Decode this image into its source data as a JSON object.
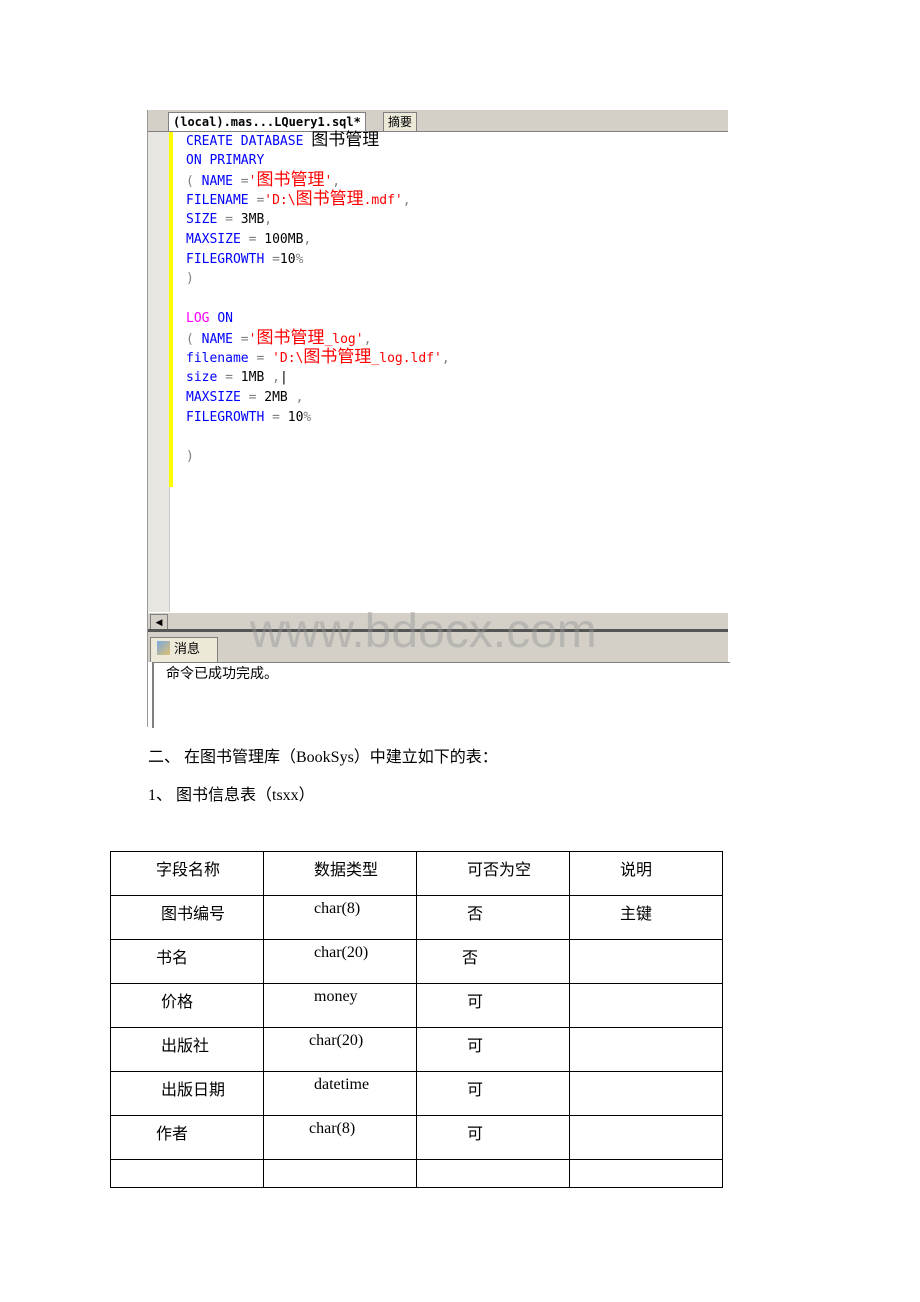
{
  "editor": {
    "tabs": [
      "(local).mas...LQuery1.sql*",
      "摘要"
    ],
    "code": [
      [
        [
          "CREATE DATABASE ",
          "kw"
        ],
        [
          "图书管理",
          "tx cjk"
        ]
      ],
      [
        [
          "ON PRIMARY",
          "kw"
        ]
      ],
      [
        [
          "( ",
          "op"
        ],
        [
          "NAME ",
          "kw"
        ],
        [
          "=",
          "op"
        ],
        [
          "'",
          "str"
        ],
        [
          "图书管理",
          "str cjk"
        ],
        [
          "'",
          "str"
        ],
        [
          ",",
          "op"
        ]
      ],
      [
        [
          "FILENAME ",
          "kw"
        ],
        [
          "=",
          "op"
        ],
        [
          "'D:\\",
          "str"
        ],
        [
          "图书管理",
          "str cjk"
        ],
        [
          ".mdf'",
          "str"
        ],
        [
          ",",
          "op"
        ]
      ],
      [
        [
          "SIZE ",
          "kw"
        ],
        [
          "= ",
          "op"
        ],
        [
          "3MB",
          ""
        ],
        [
          ",",
          "op"
        ]
      ],
      [
        [
          "MAXSIZE ",
          "kw"
        ],
        [
          "= ",
          "op"
        ],
        [
          "100MB",
          ""
        ],
        [
          ",",
          "op"
        ]
      ],
      [
        [
          "FILEGROWTH ",
          "kw"
        ],
        [
          "=",
          "op"
        ],
        [
          "10",
          ""
        ],
        [
          "%",
          "op"
        ]
      ],
      [
        [
          ")",
          "op"
        ]
      ],
      [],
      [
        [
          "LOG ",
          "fn"
        ],
        [
          "ON",
          "kw"
        ]
      ],
      [
        [
          "( ",
          "op"
        ],
        [
          "NAME ",
          "kw"
        ],
        [
          "=",
          "op"
        ],
        [
          "'",
          "str"
        ],
        [
          "图书管理",
          "str cjk"
        ],
        [
          "_log'",
          "str"
        ],
        [
          ",",
          "op"
        ]
      ],
      [
        [
          "filename ",
          "kw"
        ],
        [
          "= ",
          "op"
        ],
        [
          "'D:\\",
          "str"
        ],
        [
          "图书管理",
          "str cjk"
        ],
        [
          "_log.ldf'",
          "str"
        ],
        [
          ",",
          "op"
        ]
      ],
      [
        [
          "size ",
          "kw"
        ],
        [
          "= ",
          "op"
        ],
        [
          "1MB ",
          ""
        ],
        [
          ",",
          "op"
        ],
        [
          "|",
          ""
        ]
      ],
      [
        [
          "MAXSIZE ",
          "kw"
        ],
        [
          "= ",
          "op"
        ],
        [
          "2MB ",
          ""
        ],
        [
          ",",
          "op"
        ]
      ],
      [
        [
          "FILEGROWTH ",
          "kw"
        ],
        [
          "= ",
          "op"
        ],
        [
          "10",
          ""
        ],
        [
          "%",
          "op"
        ]
      ],
      [],
      [
        [
          ")",
          "op"
        ]
      ]
    ],
    "messages_tab": "消息",
    "message": "命令已成功完成。",
    "watermark": "www.bdocx.com"
  },
  "section_heading": "二、 在图书管理库（BookSys）中建立如下的表：",
  "subheading": "1、 图书信息表（tsxx）",
  "table": {
    "headers": [
      "字段名称",
      "数据类型",
      "可否为空",
      "说明"
    ],
    "rows": [
      [
        "图书编号",
        "char(8)",
        "否",
        "主键"
      ],
      [
        "书名",
        "char(20)",
        "否",
        ""
      ],
      [
        "价格",
        "money",
        "可",
        ""
      ],
      [
        "出版社",
        "char(20)",
        "可",
        ""
      ],
      [
        "出版日期",
        "datetime",
        "可",
        ""
      ],
      [
        "作者",
        "char(8)",
        "可",
        ""
      ],
      [
        "",
        "",
        "",
        ""
      ]
    ]
  }
}
